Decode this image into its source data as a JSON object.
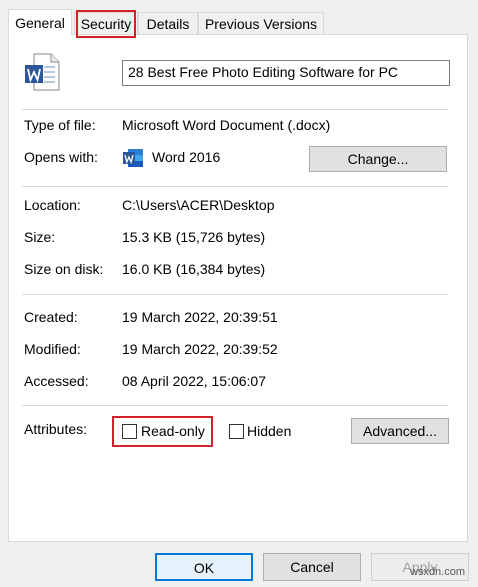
{
  "tabs": [
    {
      "label": "General"
    },
    {
      "label": "Security"
    },
    {
      "label": "Details"
    },
    {
      "label": "Previous Versions"
    }
  ],
  "file_name": "28 Best Free Photo Editing Software for PC",
  "file_type": {
    "label": "Type of file:",
    "value": "Microsoft Word Document (.docx)"
  },
  "opens_with": {
    "label": "Opens with:",
    "value": "Word 2016",
    "change_label": "Change..."
  },
  "location": {
    "label": "Location:",
    "value": "C:\\Users\\ACER\\Desktop"
  },
  "size": {
    "label": "Size:",
    "value": "15.3 KB (15,726 bytes)"
  },
  "size_on_disk": {
    "label": "Size on disk:",
    "value": "16.0 KB (16,384 bytes)"
  },
  "created": {
    "label": "Created:",
    "value": "19 March 2022, 20:39:51"
  },
  "modified": {
    "label": "Modified:",
    "value": "19 March 2022, 20:39:52"
  },
  "accessed": {
    "label": "Accessed:",
    "value": "08 April 2022, 15:06:07"
  },
  "attributes": {
    "label": "Attributes:",
    "read_only_label": "Read-only",
    "read_only_checked": false,
    "hidden_label": "Hidden",
    "hidden_checked": false,
    "advanced_label": "Advanced..."
  },
  "buttons": {
    "ok": "OK",
    "cancel": "Cancel",
    "apply": "Apply"
  },
  "icons": {
    "word_file": "word-document-icon",
    "word_app": "word-app-icon"
  },
  "colors": {
    "highlight": "#d2232a",
    "word_blue": "#2b579a"
  },
  "watermark": "wsxdn.com"
}
